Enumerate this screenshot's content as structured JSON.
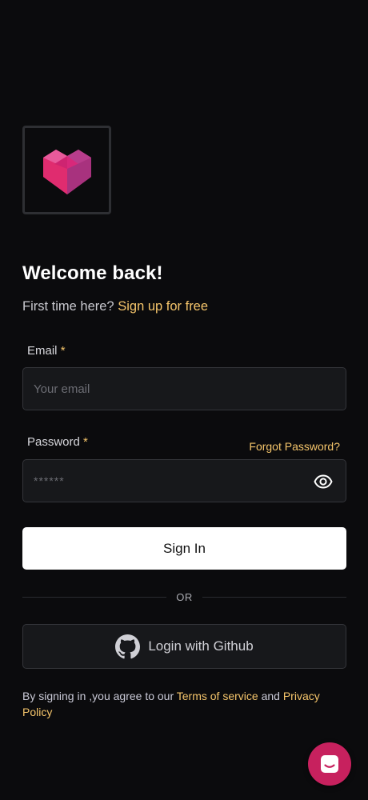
{
  "header": {
    "title": "Welcome back!",
    "subtitle_prefix": "First time here?",
    "signup_link": "Sign up for free"
  },
  "form": {
    "email_label": "Email",
    "email_required": "*",
    "email_placeholder": "Your email",
    "password_label": "Password",
    "password_required": "*",
    "password_placeholder": "******",
    "forgot_link": "Forgot Password?",
    "signin_label": "Sign In",
    "divider_text": "OR",
    "github_label": "Login with Github"
  },
  "terms": {
    "prefix": "By signing in ,you agree to our",
    "terms_link": "Terms of service",
    "and": "and",
    "privacy_link": "Privacy Policy"
  },
  "icons": {
    "logo": "heart-cube-logo",
    "eye": "eye-icon",
    "github": "github-icon",
    "chat": "chat-icon"
  },
  "colors": {
    "background": "#0b0b0d",
    "accent": "#f5c56b",
    "brand": "#c7215e",
    "input_bg": "#17181b",
    "input_border": "#34353a"
  }
}
